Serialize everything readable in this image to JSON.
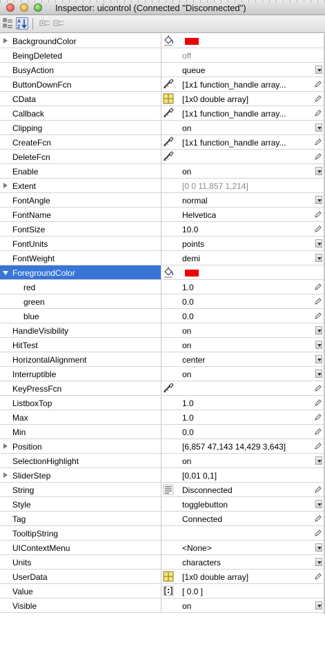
{
  "window": {
    "title": "Inspector:  uicontrol (Connected \"Disconnected\")"
  },
  "toolbar": {
    "buttons": [
      {
        "name": "categorized-view",
        "icon": "categorized-icon"
      },
      {
        "name": "sort-alphabetically",
        "icon": "sort-az-icon",
        "active": true
      },
      {
        "name": "expand-all",
        "icon": "expand-all-icon"
      },
      {
        "name": "collapse-all",
        "icon": "collapse-all-icon"
      }
    ]
  },
  "properties": [
    {
      "name": "BackgroundColor",
      "expandable": true,
      "icon": "paint-bucket-icon",
      "swatch": "#ee0000",
      "value": ""
    },
    {
      "name": "BeingDeleted",
      "value": "off",
      "disabled": true
    },
    {
      "name": "BusyAction",
      "value": "queue",
      "control": "dropdown"
    },
    {
      "name": "ButtonDownFcn",
      "icon": "function-handle-icon",
      "value": "[1x1  function_handle array...",
      "control": "edit"
    },
    {
      "name": "CData",
      "icon": "array-grid-icon",
      "value": "[1x0  double array]",
      "control": "edit"
    },
    {
      "name": "Callback",
      "icon": "function-handle-icon",
      "value": "[1x1  function_handle array...",
      "control": "edit"
    },
    {
      "name": "Clipping",
      "value": "on",
      "control": "dropdown"
    },
    {
      "name": "CreateFcn",
      "icon": "function-handle-icon",
      "value": "[1x1  function_handle array...",
      "control": "edit"
    },
    {
      "name": "DeleteFcn",
      "icon": "function-handle-icon",
      "value": "",
      "control": "edit"
    },
    {
      "name": "Enable",
      "value": "on",
      "control": "dropdown"
    },
    {
      "name": "Extent",
      "expandable": true,
      "value": "[0 0 11,857 1,214]",
      "disabled": true
    },
    {
      "name": "FontAngle",
      "value": "normal",
      "control": "dropdown"
    },
    {
      "name": "FontName",
      "value": "Helvetica",
      "control": "edit"
    },
    {
      "name": "FontSize",
      "value": "10.0",
      "control": "edit"
    },
    {
      "name": "FontUnits",
      "value": "points",
      "control": "dropdown"
    },
    {
      "name": "FontWeight",
      "value": "demi",
      "control": "dropdown"
    },
    {
      "name": "ForegroundColor",
      "expandable": true,
      "expanded": true,
      "selected": true,
      "icon": "paint-bucket-icon",
      "swatch": "#ee0000",
      "value": ""
    },
    {
      "name": "red",
      "child": true,
      "value": "1.0",
      "control": "edit"
    },
    {
      "name": "green",
      "child": true,
      "value": "0.0",
      "control": "edit"
    },
    {
      "name": "blue",
      "child": true,
      "value": "0.0",
      "control": "edit"
    },
    {
      "name": "HandleVisibility",
      "value": "on",
      "control": "dropdown"
    },
    {
      "name": "HitTest",
      "value": "on",
      "control": "dropdown"
    },
    {
      "name": "HorizontalAlignment",
      "value": "center",
      "control": "dropdown"
    },
    {
      "name": "Interruptible",
      "value": "on",
      "control": "dropdown"
    },
    {
      "name": "KeyPressFcn",
      "icon": "function-handle-icon",
      "value": "",
      "control": "edit"
    },
    {
      "name": "ListboxTop",
      "value": "1.0",
      "control": "edit"
    },
    {
      "name": "Max",
      "value": "1.0",
      "control": "edit"
    },
    {
      "name": "Min",
      "value": "0.0",
      "control": "edit"
    },
    {
      "name": "Position",
      "expandable": true,
      "value": "[6,857 47,143 14,429 3,643]",
      "control": "edit"
    },
    {
      "name": "SelectionHighlight",
      "value": "on",
      "control": "dropdown"
    },
    {
      "name": "SliderStep",
      "expandable": true,
      "value": "[0,01 0,1]"
    },
    {
      "name": "String",
      "icon": "text-lines-icon",
      "value": "Disconnected",
      "control": "edit"
    },
    {
      "name": "Style",
      "value": "togglebutton",
      "control": "dropdown"
    },
    {
      "name": "Tag",
      "value": "Connected",
      "control": "edit"
    },
    {
      "name": "TooltipString",
      "value": "",
      "control": "edit"
    },
    {
      "name": "UIContextMenu",
      "value": "<None>",
      "control": "dropdown"
    },
    {
      "name": "Units",
      "value": "characters",
      "control": "dropdown"
    },
    {
      "name": "UserData",
      "icon": "array-grid-icon",
      "value": "[1x0  double array]",
      "control": "edit"
    },
    {
      "name": "Value",
      "icon": "matrix-icon",
      "value": "[ 0.0 ]"
    },
    {
      "name": "Visible",
      "value": "on",
      "control": "dropdown"
    }
  ]
}
